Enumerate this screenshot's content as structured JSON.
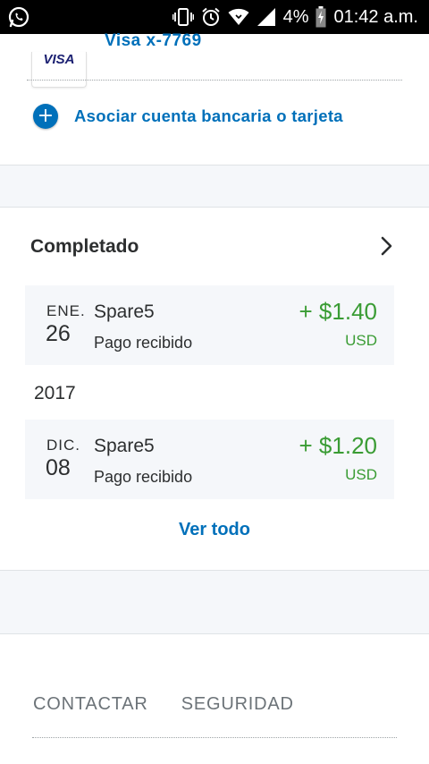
{
  "status_bar": {
    "battery": "4%",
    "time": "01:42 a.m.",
    "icons": [
      "whatsapp-icon",
      "vibrate-icon",
      "alarm-icon",
      "wifi-icon",
      "signal-icon",
      "battery-charging-icon"
    ]
  },
  "card": {
    "logo_text": "VISA",
    "label": "Visa x-7769"
  },
  "link_bank": {
    "icon": "plus-circle-icon",
    "label": "Asociar cuenta bancaria o tarjeta"
  },
  "completed": {
    "title": "Completado",
    "transactions": [
      {
        "month": "ENE.",
        "day": "26",
        "name": "Spare5",
        "description": "Pago recibido",
        "amount": "+ $1.40",
        "currency": "USD"
      },
      {
        "month": "DIC.",
        "day": "08",
        "name": "Spare5",
        "description": "Pago recibido",
        "amount": "+ $1.20",
        "currency": "USD"
      }
    ],
    "year_separator": "2017",
    "see_all": "Ver todo"
  },
  "footer": {
    "contact": "CONTACTAR",
    "security": "SEGURIDAD"
  },
  "colors": {
    "brand_blue": "#0070ba",
    "positive_green": "#3a9c34",
    "band_gray": "#f5f7fa"
  }
}
